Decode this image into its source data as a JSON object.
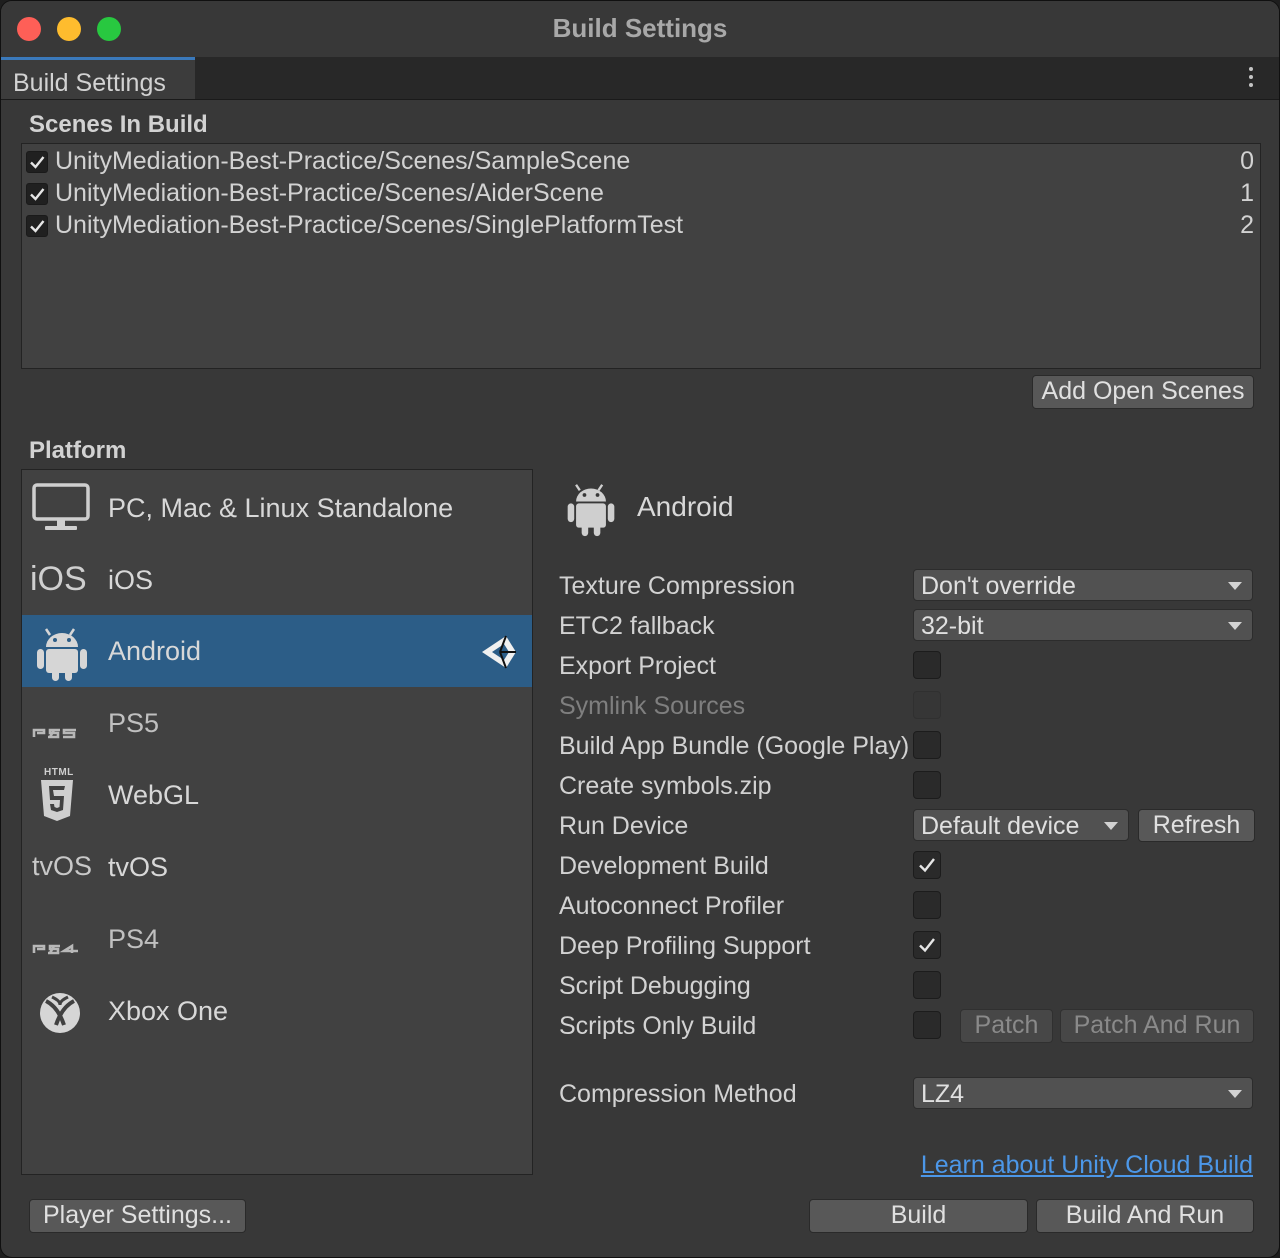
{
  "window": {
    "title": "Build Settings"
  },
  "tab": {
    "label": "Build Settings"
  },
  "scenes": {
    "header": "Scenes In Build",
    "items": [
      {
        "path": "UnityMediation-Best-Practice/Scenes/SampleScene",
        "index": "0",
        "checked": true
      },
      {
        "path": "UnityMediation-Best-Practice/Scenes/AiderScene",
        "index": "1",
        "checked": true
      },
      {
        "path": "UnityMediation-Best-Practice/Scenes/SinglePlatformTest",
        "index": "2",
        "checked": true
      }
    ],
    "add_open_scenes": "Add Open Scenes"
  },
  "platform": {
    "header": "Platform",
    "items": [
      {
        "label": "PC, Mac & Linux Standalone",
        "icon": "monitor-icon"
      },
      {
        "label": "iOS",
        "icon": "ios-icon",
        "icon_text": "iOS"
      },
      {
        "label": "Android",
        "icon": "android-icon",
        "selected": true
      },
      {
        "label": "PS5",
        "icon": "ps5-icon"
      },
      {
        "label": "WebGL",
        "icon": "html5-icon",
        "icon_text": "HTML"
      },
      {
        "label": "tvOS",
        "icon": "tvos-icon",
        "icon_text": "tvOS"
      },
      {
        "label": "PS4",
        "icon": "ps4-icon"
      },
      {
        "label": "Xbox One",
        "icon": "xbox-icon"
      }
    ],
    "selected_title": "Android",
    "colors": {
      "selected": "#2c5d87",
      "accent_tab": "#3a79bb",
      "link": "#4c97e8"
    }
  },
  "settings": {
    "texture_compression": {
      "label": "Texture Compression",
      "value": "Don't override"
    },
    "etc2_fallback": {
      "label": "ETC2 fallback",
      "value": "32-bit"
    },
    "export_project": {
      "label": "Export Project",
      "checked": false
    },
    "symlink_sources": {
      "label": "Symlink Sources",
      "checked": false,
      "disabled": true
    },
    "build_app_bundle": {
      "label": "Build App Bundle (Google Play)",
      "checked": false
    },
    "create_symbols": {
      "label": "Create symbols.zip",
      "checked": false
    },
    "run_device": {
      "label": "Run Device",
      "value": "Default device",
      "refresh": "Refresh"
    },
    "development_build": {
      "label": "Development Build",
      "checked": true
    },
    "autoconnect_profiler": {
      "label": "Autoconnect Profiler",
      "checked": false
    },
    "deep_profiling": {
      "label": "Deep Profiling Support",
      "checked": true
    },
    "script_debugging": {
      "label": "Script Debugging",
      "checked": false
    },
    "scripts_only": {
      "label": "Scripts Only Build",
      "checked": false,
      "patch": "Patch",
      "patch_and_run": "Patch And Run"
    },
    "compression_method": {
      "label": "Compression Method",
      "value": "LZ4"
    }
  },
  "footer": {
    "cloud_link": "Learn about Unity Cloud Build",
    "player_settings": "Player Settings...",
    "build": "Build",
    "build_and_run": "Build And Run"
  }
}
